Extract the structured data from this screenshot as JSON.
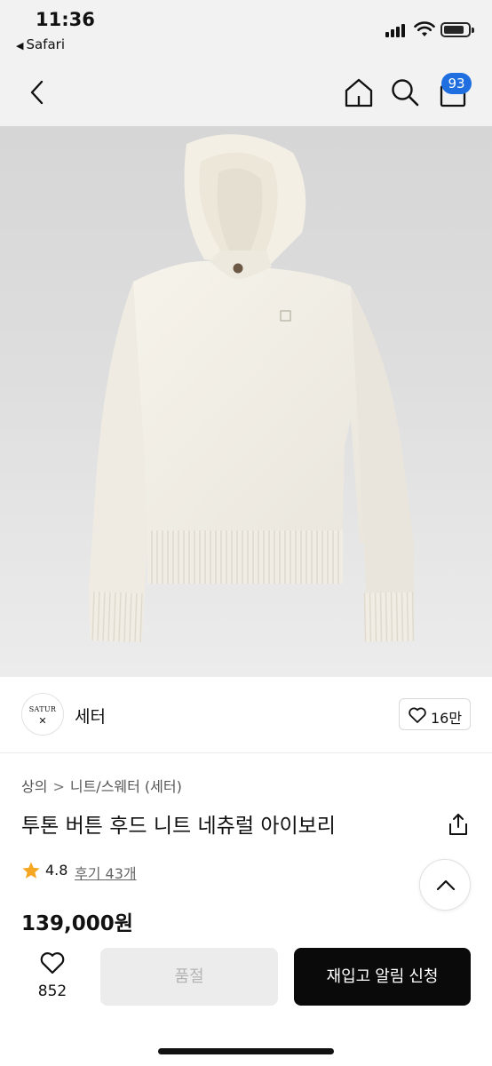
{
  "status_bar": {
    "time": "11:36",
    "back_app": "Safari",
    "icons": [
      "signal-icon",
      "wifi-icon",
      "battery-icon"
    ]
  },
  "nav": {
    "icons": [
      "back-chevron-icon",
      "home-icon",
      "search-icon",
      "cart-icon"
    ],
    "cart_badge": "93",
    "badge_color": "#1f6fe0"
  },
  "product_image": {
    "icon": "hoodie-sweater-product-photo"
  },
  "brand": {
    "logo_text": "SATUR",
    "logo_mark": "✕",
    "name": "세터",
    "like_count": "16만"
  },
  "breadcrumb": {
    "items": [
      "상의",
      "니트/스웨터 (세터)"
    ],
    "separator": ">"
  },
  "product": {
    "title": "투톤 버튼 후드 니트 네츄럴 아이보리",
    "rating": "4.8",
    "reviews": "후기 43개",
    "price": "139,000원",
    "star_color": "#f5a623"
  },
  "bottom_bar": {
    "wish_count": "852",
    "soldout_label": "품절",
    "restock_label": "재입고 알림 신청"
  }
}
